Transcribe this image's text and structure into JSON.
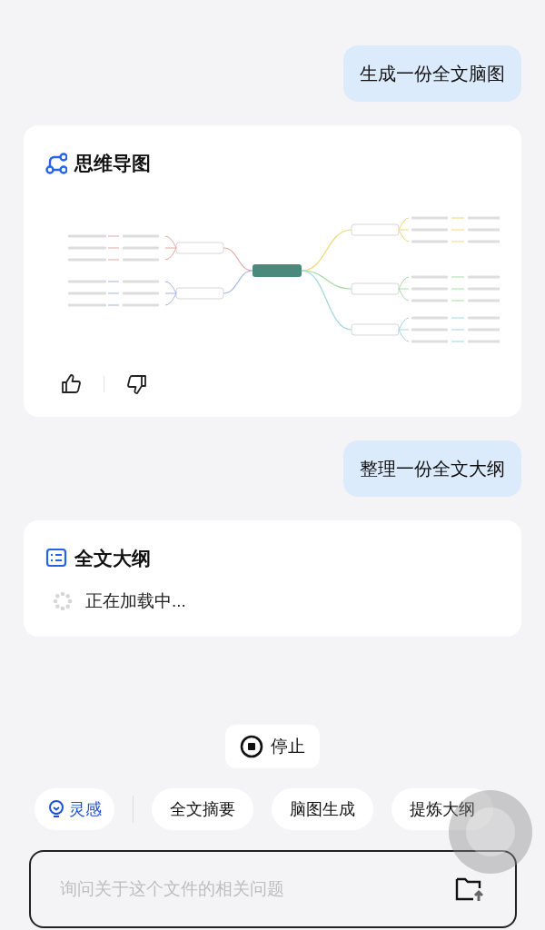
{
  "messages": [
    {
      "kind": "user",
      "text": "生成一份全文脑图"
    },
    {
      "kind": "mindmap_card",
      "title": "思维导图"
    },
    {
      "kind": "user",
      "text": "整理一份全文大纲"
    },
    {
      "kind": "outline_card",
      "title": "全文大纲",
      "status": "正在加载中..."
    }
  ],
  "stop_button": "停止",
  "chips": [
    {
      "label": "灵感",
      "kind": "accent"
    },
    {
      "label": "全文摘要",
      "kind": "plain"
    },
    {
      "label": "脑图生成",
      "kind": "plain"
    },
    {
      "label": "提炼大纲",
      "kind": "plain"
    }
  ],
  "input": {
    "placeholder": "询问关于这个文件的相关问题"
  }
}
